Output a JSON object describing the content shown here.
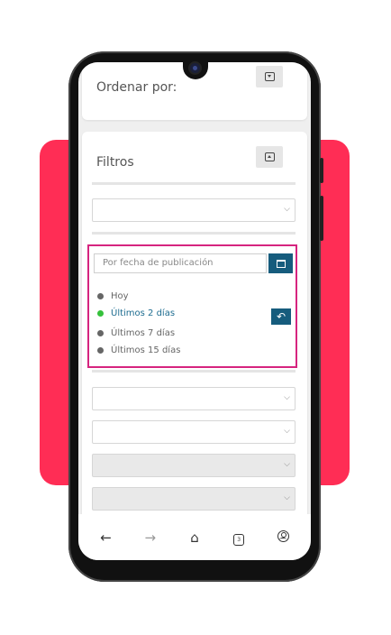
{
  "colors": {
    "accent": "#ff2d55",
    "highlight_border": "#d6247f",
    "primary_button": "#165c7d",
    "active_dot": "#35c13b"
  },
  "order": {
    "title": "Ordenar por:",
    "toggle_icon": "caret-square-down-icon"
  },
  "filters": {
    "title": "Filtros",
    "toggle_icon": "caret-square-up-icon",
    "date_filter": {
      "placeholder": "Por fecha de publicación",
      "options": [
        {
          "label": "Hoy",
          "selected": false
        },
        {
          "label": "Últimos 2 días",
          "selected": true
        },
        {
          "label": "Últimos 7 días",
          "selected": false
        },
        {
          "label": "Últimos 15 días",
          "selected": false
        }
      ]
    }
  },
  "navbar": {
    "back": "←",
    "forward": "→",
    "home": "⌂",
    "tabs_count": "3"
  }
}
